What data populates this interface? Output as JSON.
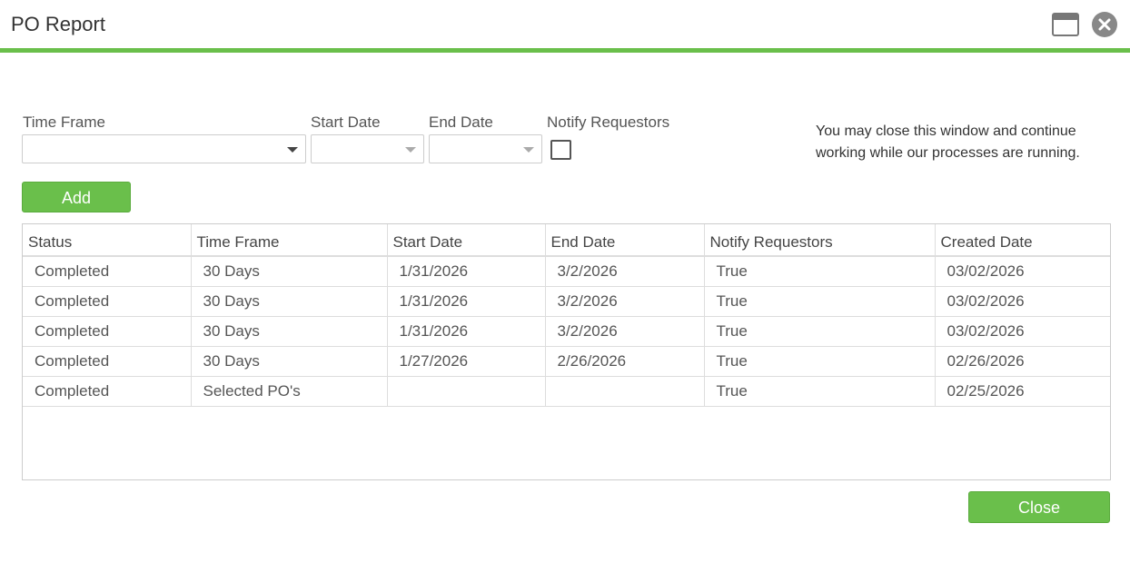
{
  "window": {
    "title": "PO Report"
  },
  "form": {
    "time_frame_label": "Time Frame",
    "time_frame_value": "",
    "start_date_label": "Start Date",
    "start_date_value": "",
    "end_date_label": "End Date",
    "end_date_value": "",
    "notify_label": "Notify Requestors",
    "notify_checked": false,
    "info_line1": "You may close this window and continue",
    "info_line2": "working while our processes are running.",
    "add_label": "Add"
  },
  "table": {
    "columns": [
      "Status",
      "Time Frame",
      "Start Date",
      "End Date",
      "Notify Requestors",
      "Created Date"
    ],
    "rows": [
      [
        "Completed",
        "30 Days",
        "1/31/2026",
        "3/2/2026",
        "True",
        "03/02/2026"
      ],
      [
        "Completed",
        "30 Days",
        "1/31/2026",
        "3/2/2026",
        "True",
        "03/02/2026"
      ],
      [
        "Completed",
        "30 Days",
        "1/31/2026",
        "3/2/2026",
        "True",
        "03/02/2026"
      ],
      [
        "Completed",
        "30 Days",
        "1/27/2026",
        "2/26/2026",
        "True",
        "02/26/2026"
      ],
      [
        "Completed",
        "Selected PO's",
        "",
        "",
        "True",
        "02/25/2026"
      ]
    ]
  },
  "footer": {
    "close_label": "Close"
  },
  "colors": {
    "accent": "#6abf4b"
  },
  "icons": {
    "maximize": "maximize-icon",
    "close": "close-icon",
    "dropdown": "chevron-down-icon"
  }
}
